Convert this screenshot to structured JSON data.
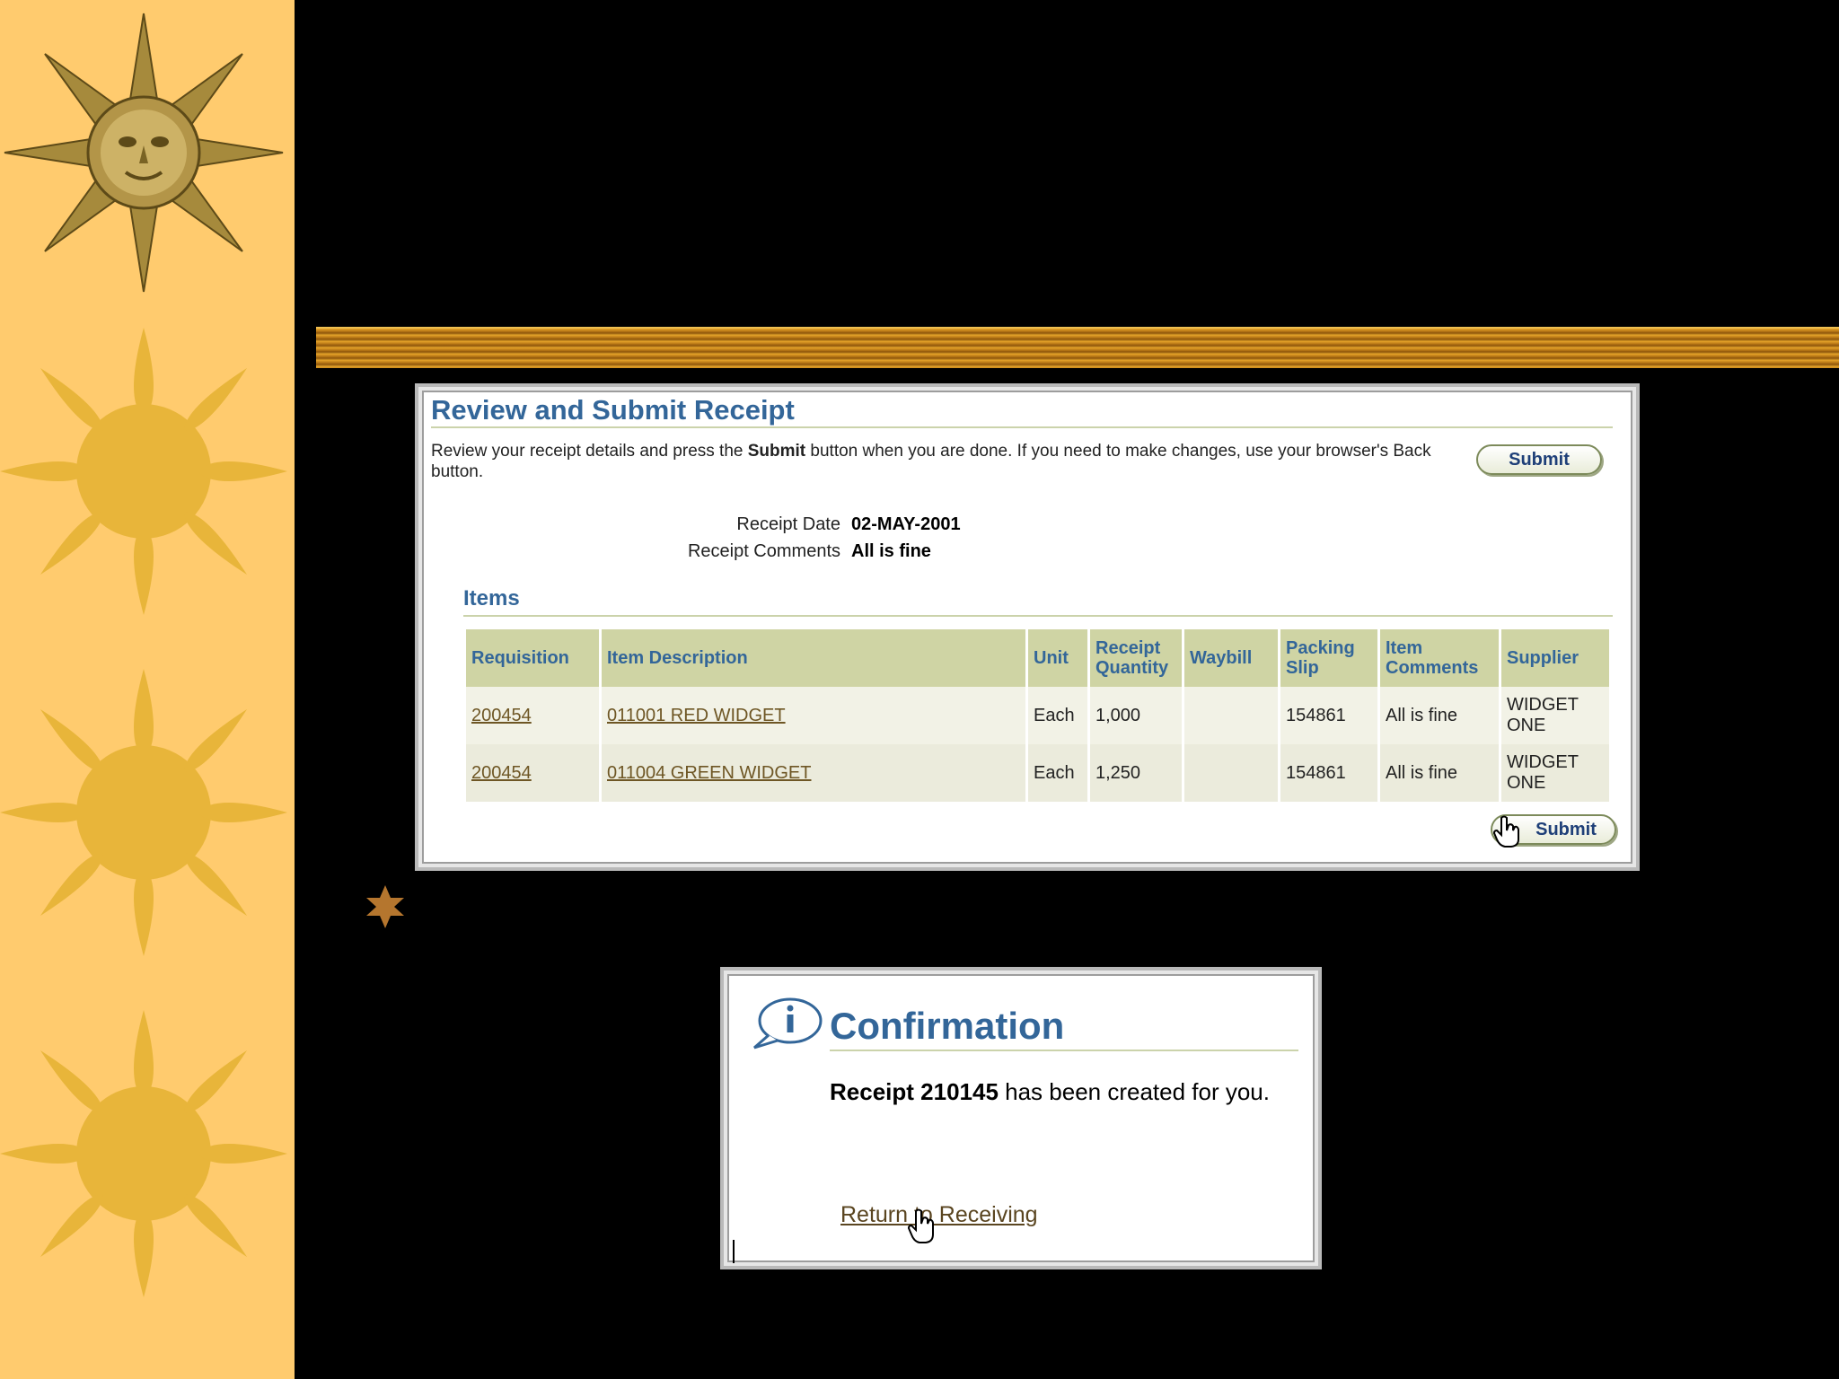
{
  "review": {
    "title": "Review and Submit Receipt",
    "instruction_pre": "Review your receipt details and press the ",
    "instruction_bold": "Submit",
    "instruction_post": " button when you are done. If you need to make changes, use your browser's Back button.",
    "submit_label": "Submit",
    "receipt_date_label": "Receipt Date",
    "receipt_date_value": "02-MAY-2001",
    "receipt_comments_label": "Receipt Comments",
    "receipt_comments_value": "All is fine",
    "items_title": "Items",
    "columns": [
      "Requisition",
      "Item Description",
      "Unit",
      "Receipt Quantity",
      "Waybill",
      "Packing Slip",
      "Item Comments",
      "Supplier"
    ],
    "rows": [
      {
        "requisition": "200454",
        "description": "011001 RED WIDGET",
        "unit": "Each",
        "quantity": "1,000",
        "waybill": "",
        "packing_slip": "154861",
        "comments": "All is fine",
        "supplier": "WIDGET ONE"
      },
      {
        "requisition": "200454",
        "description": "011004 GREEN WIDGET",
        "unit": "Each",
        "quantity": "1,250",
        "waybill": "",
        "packing_slip": "154861",
        "comments": "All is fine",
        "supplier": "WIDGET ONE"
      }
    ]
  },
  "confirmation": {
    "title": "Confirmation",
    "message_bold": "Receipt 210145",
    "message_rest": " has been created for you.",
    "link_label": "Return to Receiving"
  },
  "colors": {
    "sidebar": "#ffcb6e",
    "sun": "#e8b53a",
    "title_blue": "#336699",
    "header_green": "#cfd4a4"
  }
}
